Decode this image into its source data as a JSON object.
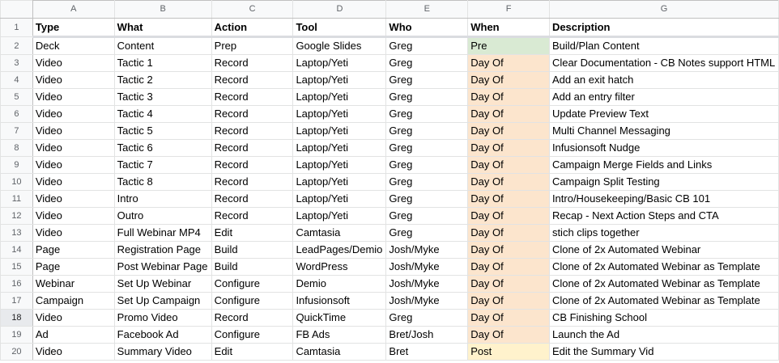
{
  "columns": [
    "A",
    "B",
    "C",
    "D",
    "E",
    "F",
    "G"
  ],
  "rows": [
    {
      "num": "1",
      "cells": [
        "Type",
        "What",
        "Action",
        "Tool",
        "Who",
        "When",
        "Description"
      ],
      "when_class": ""
    },
    {
      "num": "2",
      "cells": [
        "Deck",
        "Content",
        "Prep",
        "Google Slides",
        "Greg",
        "Pre",
        "Build/Plan Content"
      ],
      "when_class": "pre"
    },
    {
      "num": "3",
      "cells": [
        "Video",
        "Tactic 1",
        "Record",
        "Laptop/Yeti",
        "Greg",
        "Day Of",
        "Clear Documentation - CB Notes support HTML"
      ],
      "when_class": "dayof"
    },
    {
      "num": "4",
      "cells": [
        "Video",
        "Tactic 2",
        "Record",
        "Laptop/Yeti",
        "Greg",
        "Day Of",
        "Add an exit hatch"
      ],
      "when_class": "dayof"
    },
    {
      "num": "5",
      "cells": [
        "Video",
        "Tactic 3",
        "Record",
        "Laptop/Yeti",
        "Greg",
        "Day Of",
        "Add an entry filter"
      ],
      "when_class": "dayof"
    },
    {
      "num": "6",
      "cells": [
        "Video",
        "Tactic 4",
        "Record",
        "Laptop/Yeti",
        "Greg",
        "Day Of",
        "Update Preview Text"
      ],
      "when_class": "dayof"
    },
    {
      "num": "7",
      "cells": [
        "Video",
        "Tactic 5",
        "Record",
        "Laptop/Yeti",
        "Greg",
        "Day Of",
        "Multi Channel Messaging"
      ],
      "when_class": "dayof"
    },
    {
      "num": "8",
      "cells": [
        "Video",
        "Tactic 6",
        "Record",
        "Laptop/Yeti",
        "Greg",
        "Day Of",
        "Infusionsoft Nudge"
      ],
      "when_class": "dayof"
    },
    {
      "num": "9",
      "cells": [
        "Video",
        "Tactic 7",
        "Record",
        "Laptop/Yeti",
        "Greg",
        "Day Of",
        "Campaign Merge Fields and Links"
      ],
      "when_class": "dayof"
    },
    {
      "num": "10",
      "cells": [
        "Video",
        "Tactic 8",
        "Record",
        "Laptop/Yeti",
        "Greg",
        "Day Of",
        "Campaign Split Testing"
      ],
      "when_class": "dayof"
    },
    {
      "num": "11",
      "cells": [
        "Video",
        "Intro",
        "Record",
        "Laptop/Yeti",
        "Greg",
        "Day Of",
        "Intro/Housekeeping/Basic CB 101"
      ],
      "when_class": "dayof"
    },
    {
      "num": "12",
      "cells": [
        "Video",
        "Outro",
        "Record",
        "Laptop/Yeti",
        "Greg",
        "Day Of",
        "Recap - Next Action Steps and CTA"
      ],
      "when_class": "dayof"
    },
    {
      "num": "13",
      "cells": [
        "Video",
        "Full Webinar MP4",
        "Edit",
        "Camtasia",
        "Greg",
        "Day Of",
        "stich clips together"
      ],
      "when_class": "dayof"
    },
    {
      "num": "14",
      "cells": [
        "Page",
        "Registration Page",
        "Build",
        "LeadPages/Demio",
        "Josh/Myke",
        "Day Of",
        "Clone of 2x Automated Webinar"
      ],
      "when_class": "dayof"
    },
    {
      "num": "15",
      "cells": [
        "Page",
        "Post Webinar Page",
        "Build",
        "WordPress",
        "Josh/Myke",
        "Day Of",
        "Clone of 2x Automated Webinar as Template"
      ],
      "when_class": "dayof"
    },
    {
      "num": "16",
      "cells": [
        "Webinar",
        "Set Up Webinar",
        "Configure",
        "Demio",
        "Josh/Myke",
        "Day Of",
        "Clone of 2x Automated Webinar as Template"
      ],
      "when_class": "dayof"
    },
    {
      "num": "17",
      "cells": [
        "Campaign",
        "Set Up Campaign",
        "Configure",
        "Infusionsoft",
        "Josh/Myke",
        "Day Of",
        "Clone of 2x Automated Webinar as Template"
      ],
      "when_class": "dayof"
    },
    {
      "num": "18",
      "cells": [
        "Video",
        "Promo Video",
        "Record",
        "QuickTime",
        "Greg",
        "Day Of",
        "CB Finishing School"
      ],
      "when_class": "dayof"
    },
    {
      "num": "19",
      "cells": [
        "Ad",
        "Facebook Ad",
        "Configure",
        "FB Ads",
        "Bret/Josh",
        "Day Of",
        "Launch the Ad"
      ],
      "when_class": "dayof"
    },
    {
      "num": "20",
      "cells": [
        "Video",
        "Summary Video",
        "Edit",
        "Camtasia",
        "Bret",
        "Post",
        "Edit the Summary Vid"
      ],
      "when_class": "post"
    }
  ],
  "colors": {
    "pre": "#d9ead3",
    "day_of": "#fce5cd",
    "post": "#fff2cc",
    "header_bg": "#f8f9fa"
  }
}
